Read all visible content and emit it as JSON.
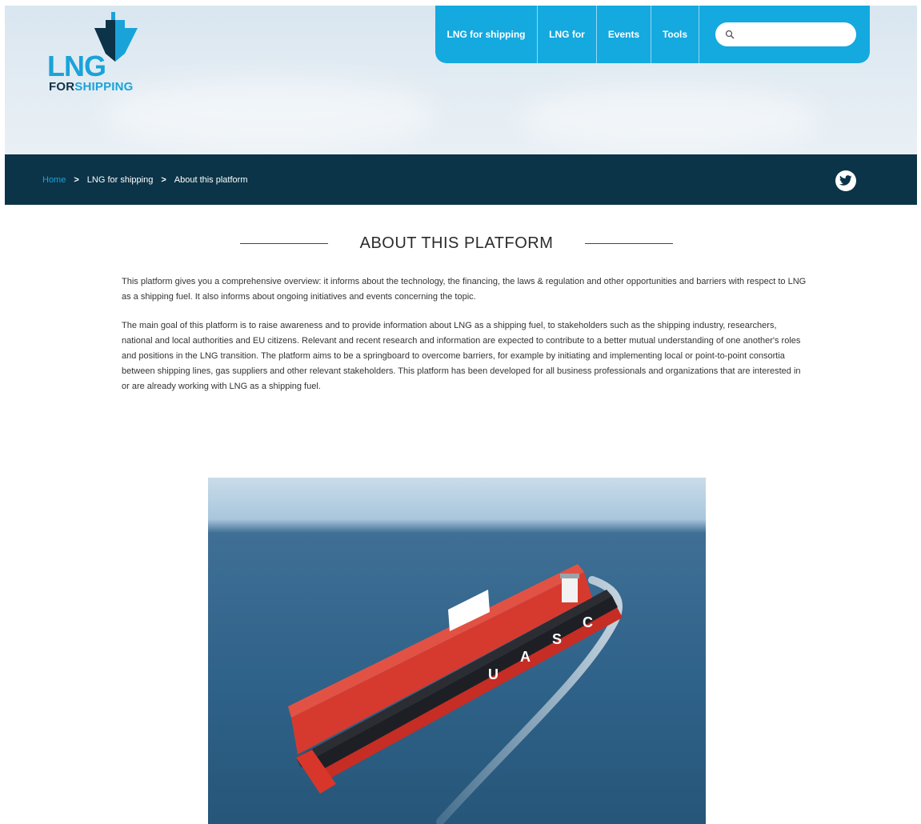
{
  "logo": {
    "line1": "LNG",
    "for": "FOR",
    "shipping": "SHIPPING"
  },
  "nav": {
    "items": [
      {
        "label": "LNG for shipping"
      },
      {
        "label": "LNG for"
      },
      {
        "label": "Events"
      },
      {
        "label": "Tools"
      }
    ],
    "search_placeholder": ""
  },
  "breadcrumb": {
    "home": "Home",
    "separator": ">",
    "level1": "LNG for shipping",
    "current": "About this platform"
  },
  "page": {
    "title": "ABOUT THIS PLATFORM",
    "paragraphs": [
      "This platform gives you a comprehensive overview: it informs about the technology, the financing, the laws & regulation and other opportunities and barriers with respect to LNG as a shipping fuel. It also informs about ongoing initiatives and events concerning the topic.",
      "The main goal of this platform is to raise awareness and to provide information about LNG as a shipping fuel, to stakeholders such as the shipping industry, researchers, national and local authorities and EU citizens. Relevant and recent research and information are expected to contribute to a better mutual understanding of one another's roles and positions in the LNG transition. The platform aims to be a springboard to overcome barriers, for example by initiating and implementing local or point-to-point consortia between shipping lines, gas suppliers and other relevant stakeholders. This platform has been developed for all business professionals and organizations that are interested in or are already working with LNG as a shipping fuel."
    ]
  },
  "photo": {
    "hull_lettering": [
      "U",
      "A",
      "S",
      "C"
    ]
  },
  "colors": {
    "brand_blue": "#14a9df",
    "dark_navy": "#0b3448",
    "hull_red": "#d9362b"
  },
  "icons": {
    "search": "search-icon",
    "twitter": "twitter-icon",
    "logo_ship": "ship-icon"
  }
}
